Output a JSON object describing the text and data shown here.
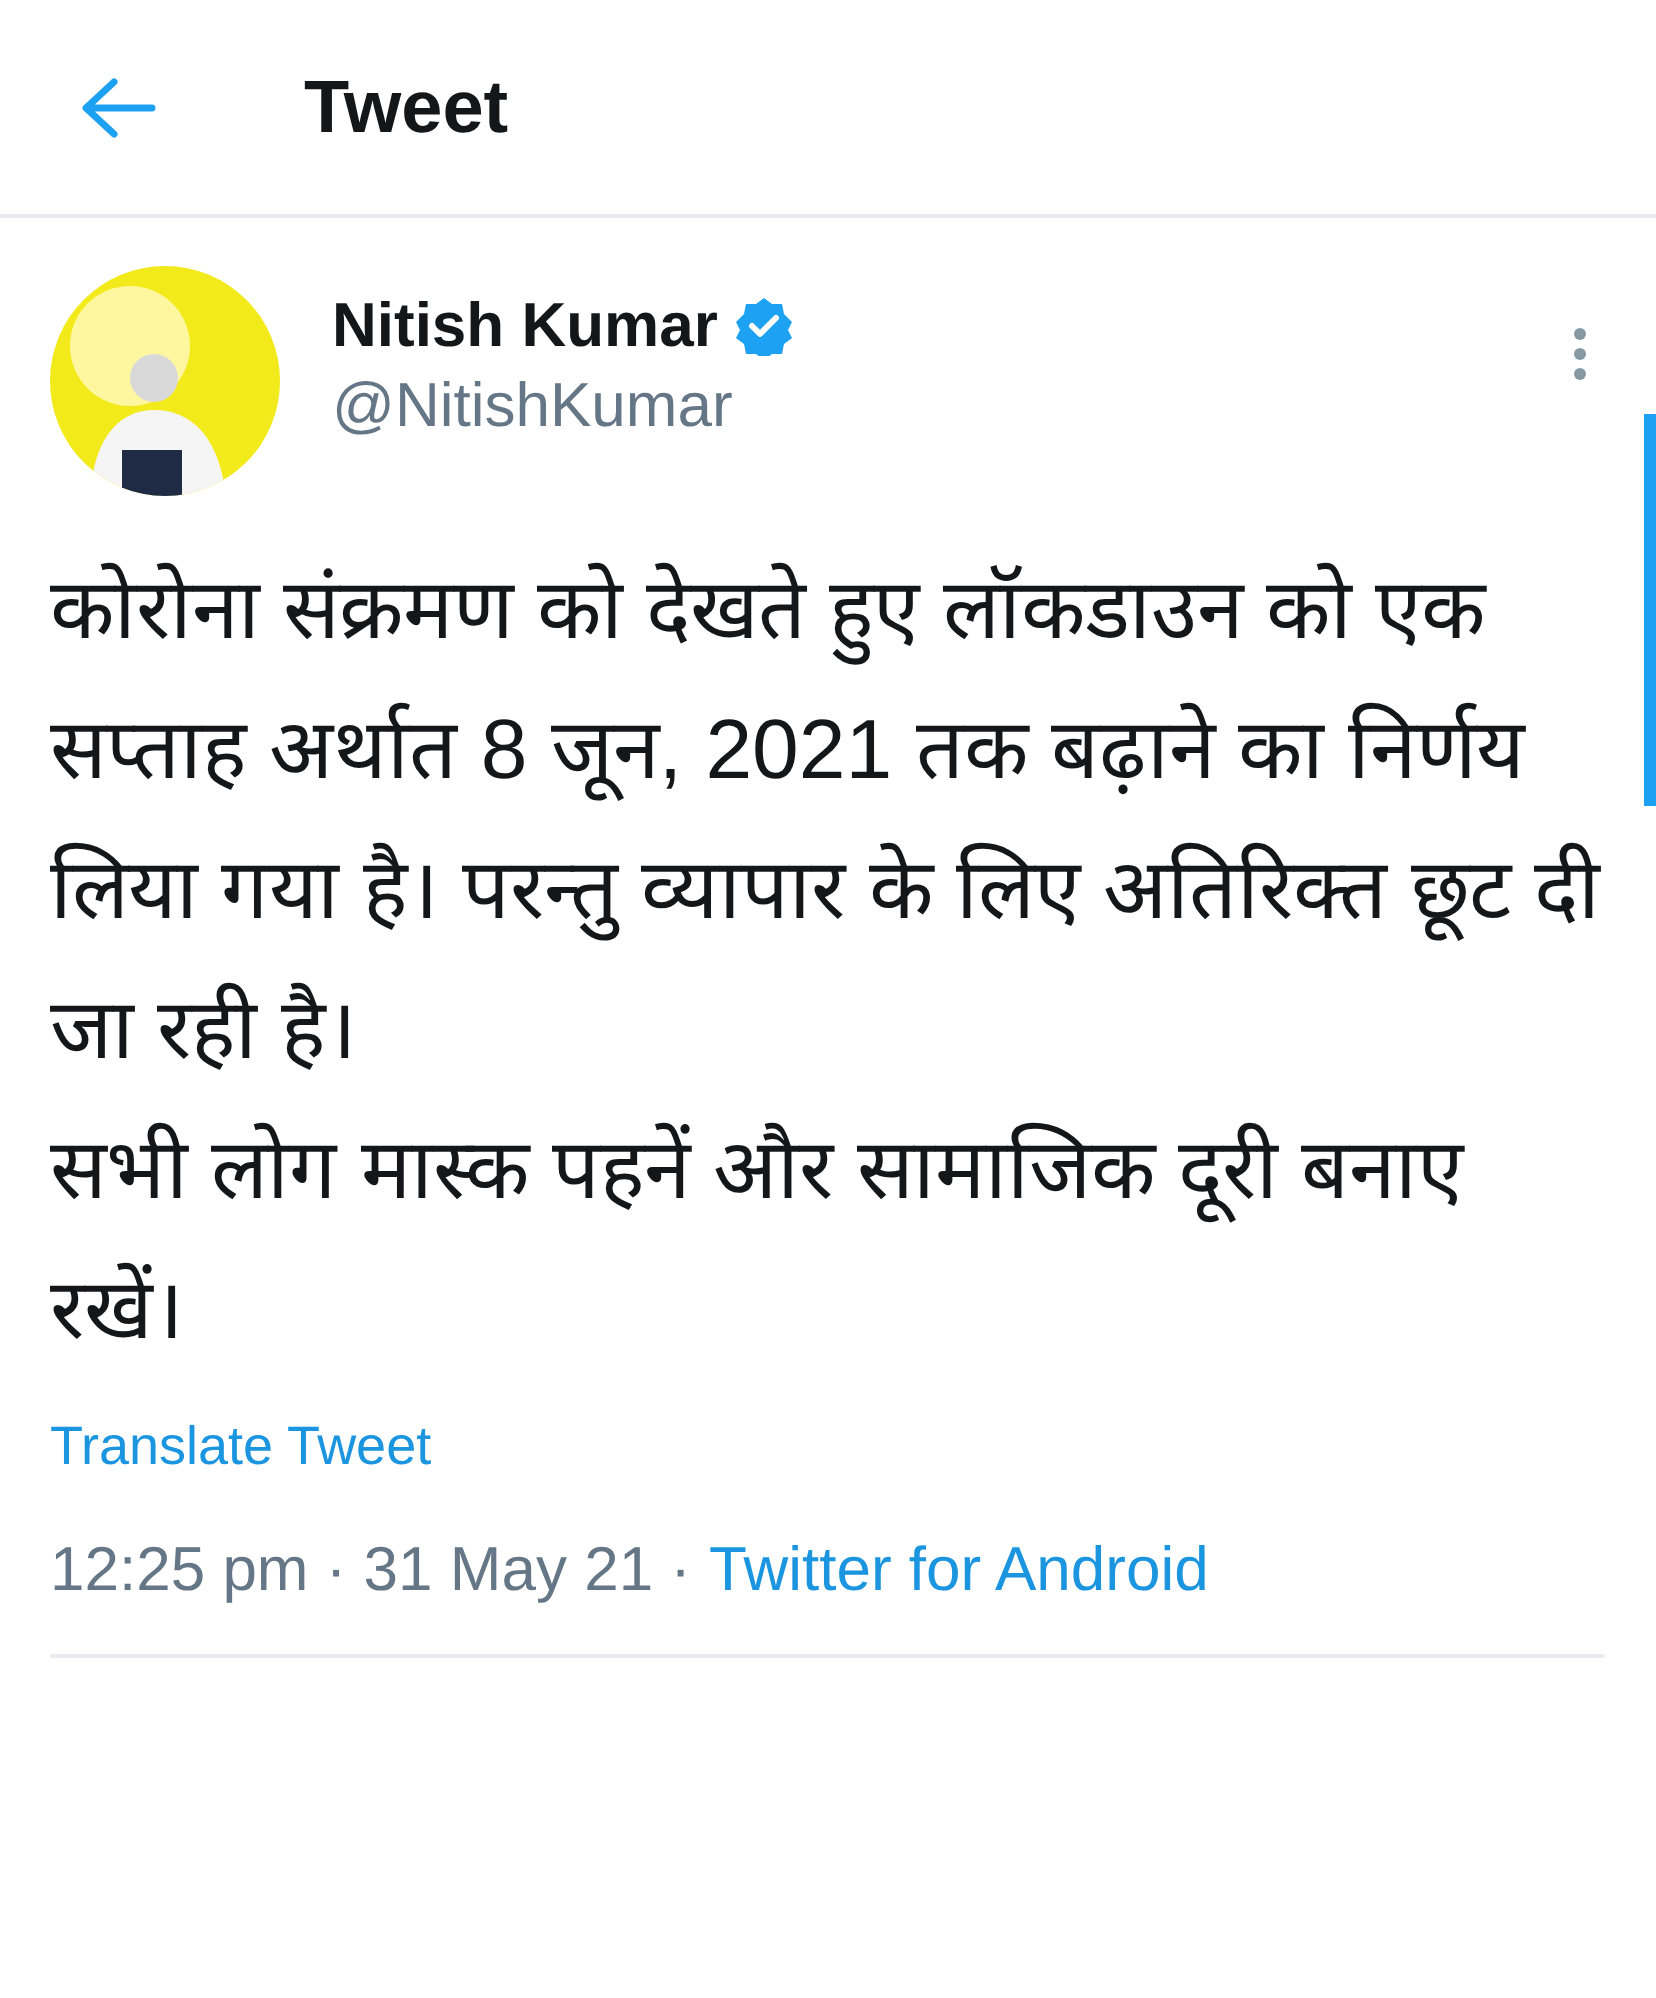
{
  "header": {
    "title": "Tweet"
  },
  "tweet": {
    "author": {
      "name": "Nitish Kumar",
      "handle": "@NitishKumar",
      "verified": true
    },
    "paragraphs": [
      "कोरोना संक्रमण को देखते हुए लॉकडाउन को एक सप्ताह अर्थात 8 जून, 2021 तक बढ़ाने का निर्णय लिया गया है। परन्तु व्यापार के लिए अतिरिक्त छूट दी जा रही है।",
      "सभी लोग मास्क पहनें और सामाजिक दूरी बनाए रखें।"
    ],
    "translate": "Translate Tweet",
    "meta": [
      {
        "kind": "text",
        "text": "12:25 pm · 31 May 21 ·"
      },
      {
        "kind": "link",
        "text": "Twitter for Android"
      }
    ]
  }
}
